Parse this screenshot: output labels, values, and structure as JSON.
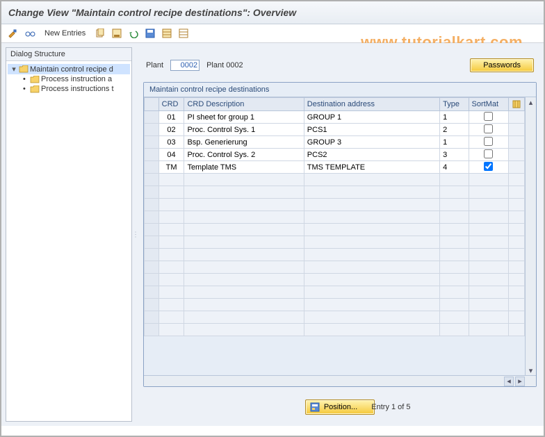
{
  "title": "Change View \"Maintain control recipe destinations\": Overview",
  "toolbar": {
    "new_entries": "New Entries"
  },
  "watermark": "www.tutorialkart.com",
  "sidebar": {
    "title": "Dialog Structure",
    "items": [
      {
        "label": "Maintain control recipe d",
        "level": 0,
        "open": true,
        "selected": true
      },
      {
        "label": "Process instruction a",
        "level": 1,
        "open": false,
        "selected": false
      },
      {
        "label": "Process instructions t",
        "level": 1,
        "open": false,
        "selected": false
      }
    ]
  },
  "plant": {
    "label": "Plant",
    "code": "0002",
    "name": "Plant 0002"
  },
  "passwords_btn": "Passwords",
  "grid": {
    "title": "Maintain control recipe destinations",
    "columns": {
      "crd": "CRD",
      "desc": "CRD Description",
      "dest": "Destination address",
      "type": "Type",
      "sort": "SortMat"
    },
    "rows": [
      {
        "crd": "01",
        "desc": "PI sheet for group 1",
        "dest": "GROUP 1",
        "type": "1",
        "sort": false,
        "highlight": true
      },
      {
        "crd": "02",
        "desc": "Proc. Control Sys. 1",
        "dest": "PCS1",
        "type": "2",
        "sort": false
      },
      {
        "crd": "03",
        "desc": "Bsp. Generierung",
        "dest": "GROUP 3",
        "type": "1",
        "sort": false
      },
      {
        "crd": "04",
        "desc": "Proc. Control Sys. 2",
        "dest": "PCS2",
        "type": "3",
        "sort": false
      },
      {
        "crd": "TM",
        "desc": "Template TMS",
        "dest": "TMS TEMPLATE",
        "type": "4",
        "sort": true
      }
    ],
    "empty_rows": 13
  },
  "footer": {
    "position_btn": "Position...",
    "entry_text": "Entry 1 of 5"
  }
}
